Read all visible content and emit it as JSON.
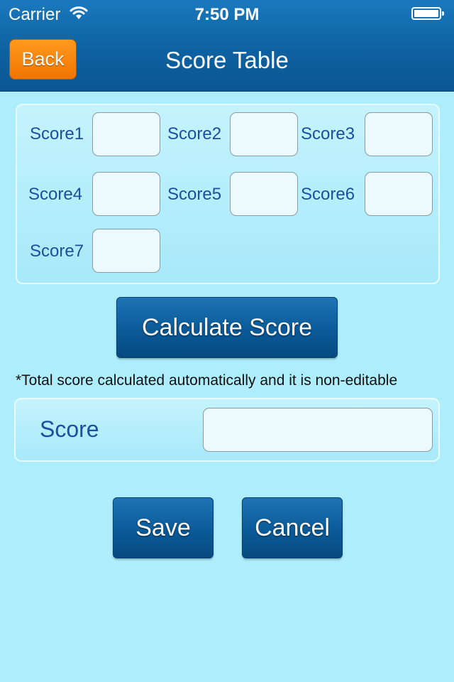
{
  "status_bar": {
    "carrier": "Carrier",
    "time": "7:50 PM"
  },
  "nav": {
    "back_label": "Back",
    "title": "Score Table"
  },
  "scores": [
    {
      "label": "Score1",
      "value": ""
    },
    {
      "label": "Score2",
      "value": ""
    },
    {
      "label": "Score3",
      "value": ""
    },
    {
      "label": "Score4",
      "value": ""
    },
    {
      "label": "Score5",
      "value": ""
    },
    {
      "label": "Score6",
      "value": ""
    },
    {
      "label": "Score7",
      "value": ""
    }
  ],
  "calculate_label": "Calculate Score",
  "note": "*Total score calculated automatically and it is non-editable",
  "total": {
    "label": "Score",
    "value": ""
  },
  "actions": {
    "save_label": "Save",
    "cancel_label": "Cancel"
  },
  "colors": {
    "nav_bar": "#0e62a2",
    "back_button": "#f58300",
    "background": "#aeeefc",
    "label_text": "#1b4fa0"
  }
}
